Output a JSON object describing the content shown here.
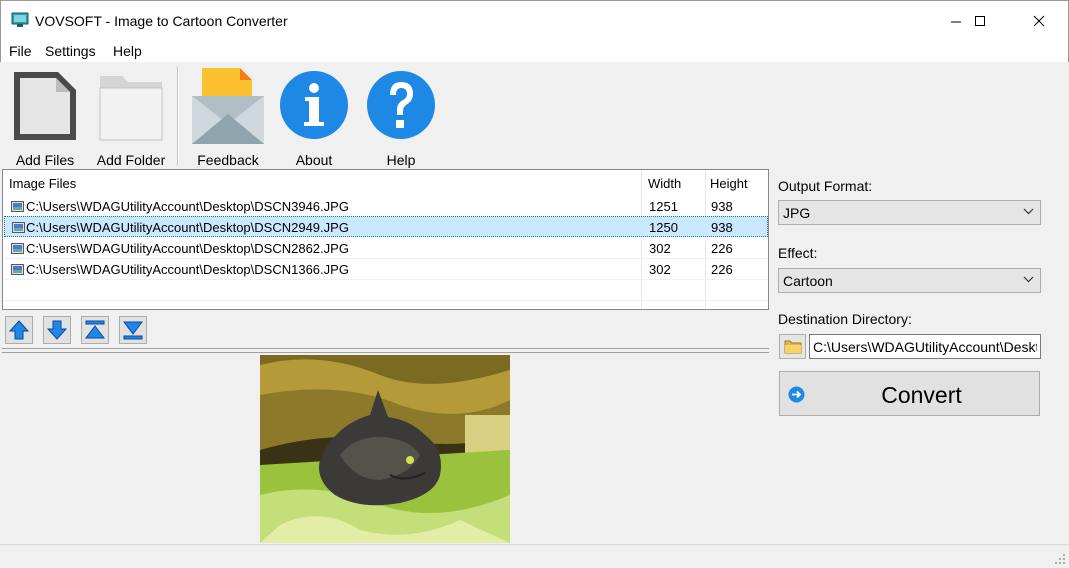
{
  "window": {
    "title": "VOVSOFT - Image to Cartoon Converter"
  },
  "menu": {
    "items": [
      "File",
      "Settings",
      "Help"
    ]
  },
  "toolbar": {
    "add_files": "Add Files",
    "add_folder": "Add Folder",
    "feedback": "Feedback",
    "about": "About",
    "help": "Help"
  },
  "file_list": {
    "headers": {
      "name": "Image Files",
      "width": "Width",
      "height": "Height"
    },
    "rows": [
      {
        "path": "C:\\Users\\WDAGUtilityAccount\\Desktop\\DSCN3946.JPG",
        "width": "1251",
        "height": "938",
        "selected": false
      },
      {
        "path": "C:\\Users\\WDAGUtilityAccount\\Desktop\\DSCN2949.JPG",
        "width": "1250",
        "height": "938",
        "selected": true
      },
      {
        "path": "C:\\Users\\WDAGUtilityAccount\\Desktop\\DSCN2862.JPG",
        "width": "302",
        "height": "226",
        "selected": false
      },
      {
        "path": "C:\\Users\\WDAGUtilityAccount\\Desktop\\DSCN1366.JPG",
        "width": "302",
        "height": "226",
        "selected": false
      }
    ]
  },
  "list_controls": {
    "icons": [
      "move-up-icon",
      "move-down-icon",
      "move-top-icon",
      "move-bottom-icon"
    ]
  },
  "settings": {
    "output_format_label": "Output Format:",
    "output_format_value": "JPG",
    "effect_label": "Effect:",
    "effect_value": "Cartoon",
    "destination_label": "Destination Directory:",
    "destination_value": "C:\\Users\\WDAGUtilityAccount\\Desktop",
    "convert_label": "Convert"
  },
  "colors": {
    "accent_blue": "#1e88e5",
    "selection": "#cce8ff",
    "feedback_yellow": "#fbc02d"
  }
}
